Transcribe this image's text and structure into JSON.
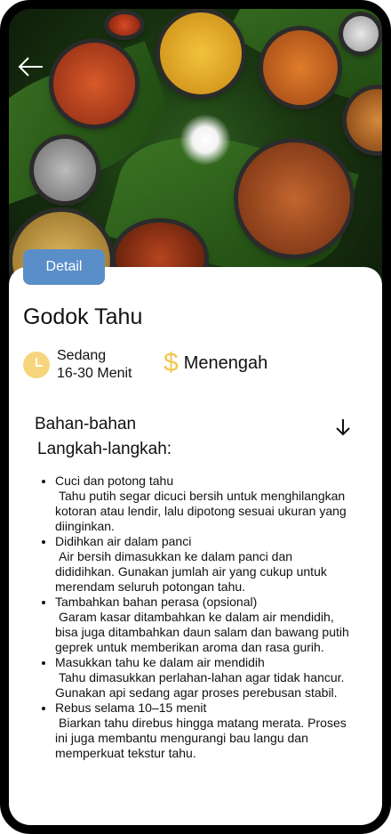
{
  "detail_button": "Detail",
  "recipe": {
    "title": "Godok Tahu",
    "difficulty": "Sedang",
    "duration": "16-30 Menit",
    "price_icon": "$",
    "price_level": "Menengah"
  },
  "sections": {
    "ingredients": "Bahan-bahan",
    "steps": "Langkah-langkah:"
  },
  "steps": [
    {
      "title": "Cuci dan potong tahu",
      "desc": "Tahu putih segar dicuci bersih untuk menghilangkan kotoran atau lendir, lalu dipotong sesuai ukuran yang diinginkan."
    },
    {
      "title": "Didihkan air dalam panci",
      "desc": "Air bersih dimasukkan ke dalam panci dan dididihkan. Gunakan jumlah air yang cukup untuk merendam seluruh potongan tahu."
    },
    {
      "title": "Tambahkan bahan perasa (opsional)",
      "desc": "Garam kasar ditambahkan ke dalam air mendidih, bisa juga ditambahkan daun salam dan bawang putih geprek untuk memberikan aroma dan rasa gurih."
    },
    {
      "title": "Masukkan tahu ke dalam air mendidih",
      "desc": "Tahu dimasukkan perlahan-lahan agar tidak hancur. Gunakan api sedang agar proses perebusan stabil."
    },
    {
      "title": "Rebus selama 10–15 menit",
      "desc": "Biarkan tahu direbus hingga matang merata. Proses ini juga membantu mengurangi bau langu dan memperkuat tekstur tahu."
    }
  ],
  "colors": {
    "accent": "#5a8ec8",
    "clock": "#f7d57d",
    "price": "#f2c64f"
  },
  "icons": {
    "back": "back-arrow-icon",
    "time": "clock-icon",
    "price": "dollar-icon",
    "expand": "arrow-down-icon"
  }
}
